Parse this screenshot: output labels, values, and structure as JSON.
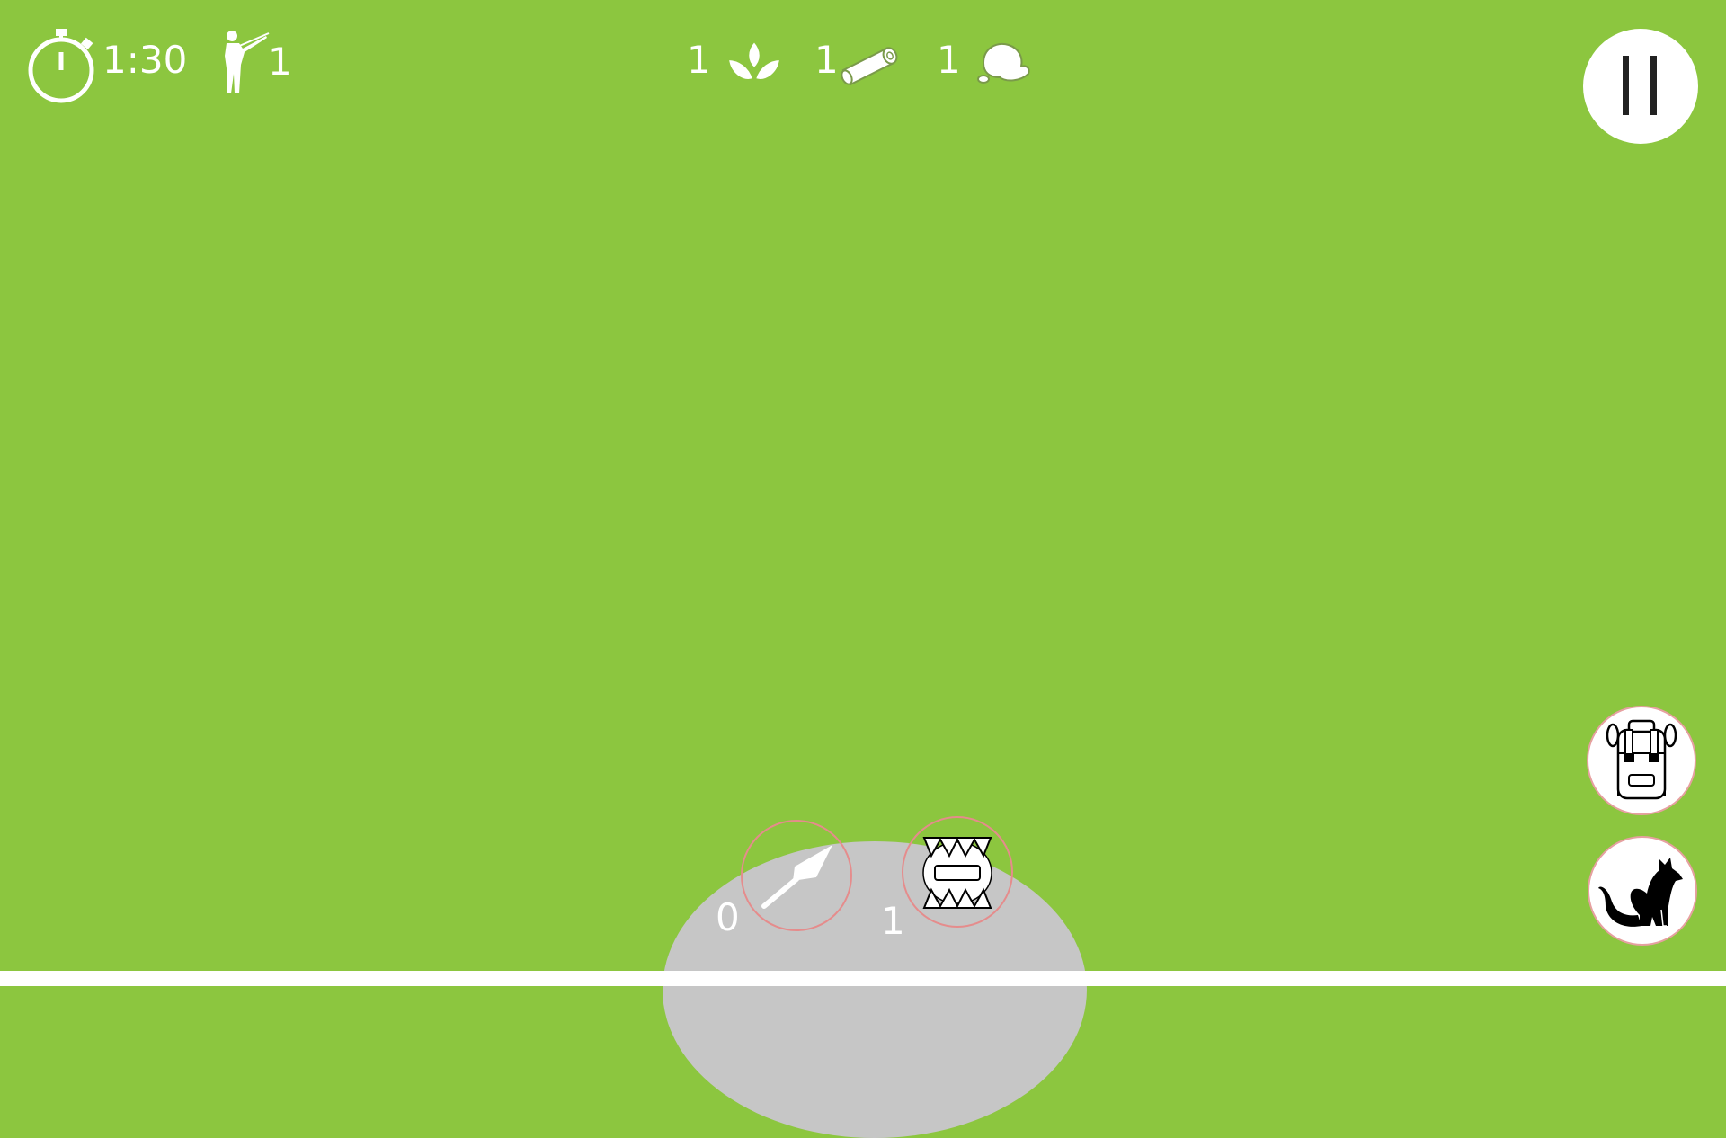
{
  "hud": {
    "timer": "1:30",
    "hunters_count": "1",
    "resources": {
      "leaves_count": "1",
      "log_count": "1",
      "stone_count": "1"
    }
  },
  "tools": {
    "spear_count": "0",
    "trap_count": "1"
  },
  "icons": {
    "timer": "stopwatch-icon",
    "hunter": "hunter-with-rifle-icon",
    "leaves": "leaves-icon",
    "log": "log-icon",
    "stone": "stone-icon",
    "pause": "pause-icon",
    "backpack": "backpack-icon",
    "fox": "fox-icon",
    "spear": "spear-icon",
    "trap": "bear-trap-icon"
  },
  "colors": {
    "background": "#8cc63f",
    "tray": "#c6c6c6",
    "slot_ring": "#e58c8c",
    "hud_text": "#ffffff"
  }
}
